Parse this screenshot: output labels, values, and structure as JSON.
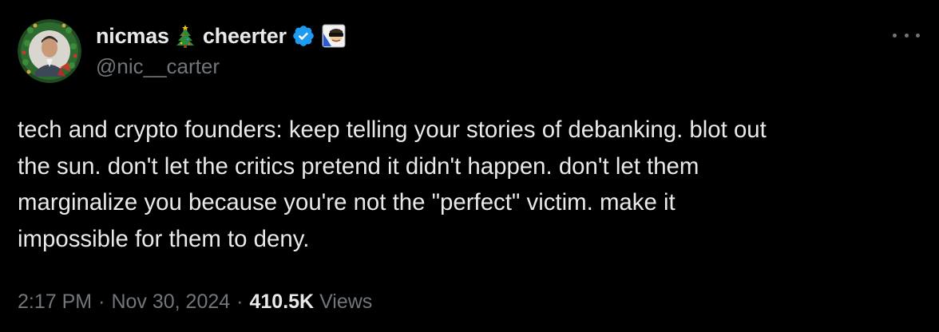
{
  "author": {
    "display_name_first": "nicmas",
    "display_name_second": "cheerter",
    "handle": "@nic__carter",
    "verified": true,
    "icons": {
      "avatar": "avatar-christmas-wreath",
      "name_emoji": "christmas-tree-icon",
      "verified": "verified-badge-icon",
      "affiliation": "affiliate-badge-icon"
    }
  },
  "more_menu": {
    "icon": "more-options-icon"
  },
  "tweet": {
    "lines": [
      "tech and crypto founders: keep telling your stories of debanking. blot out",
      "the sun. don't let the critics pretend it didn't happen. don't let them",
      "marginalize you because you're not the \"perfect\" victim. make it",
      "impossible for them to deny."
    ]
  },
  "meta": {
    "time": "2:17 PM",
    "separator": "·",
    "date": "Nov 30, 2024",
    "views_count": "410.5K",
    "views_label": "Views"
  },
  "colors": {
    "background": "#000000",
    "primary_text": "#e7e9ea",
    "secondary_text": "#71767b",
    "verified_blue": "#1d9bf0"
  }
}
